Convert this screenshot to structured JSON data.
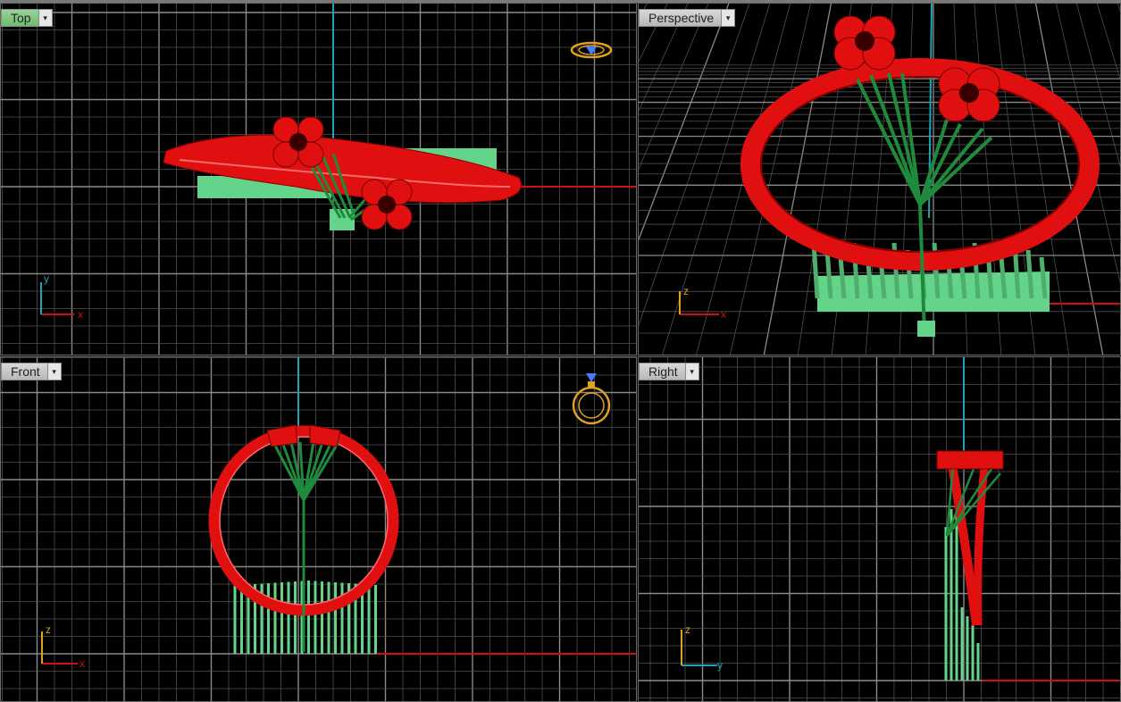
{
  "viewports": {
    "top": {
      "label": "Top",
      "axis_h": "x",
      "axis_v": "y",
      "active": true
    },
    "perspective": {
      "label": "Perspective",
      "axis_h": "x",
      "axis_v": "z",
      "active": false
    },
    "front": {
      "label": "Front",
      "axis_h": "x",
      "axis_v": "z",
      "active": false
    },
    "right": {
      "label": "Right",
      "axis_h": "y",
      "axis_v": "z",
      "active": false
    }
  },
  "dropdown_glyph": "▾",
  "colors": {
    "background": "#000000",
    "grid": "#6e6e6e",
    "ring": "#e01010",
    "support": "#64d48a",
    "stem": "#1f8a3c",
    "x_axis": "#d01010",
    "y_axis": "#1aa6b8",
    "active_tab": "#7cc47c"
  },
  "icons": [
    "ring-top-icon",
    "ring-front-icon"
  ]
}
